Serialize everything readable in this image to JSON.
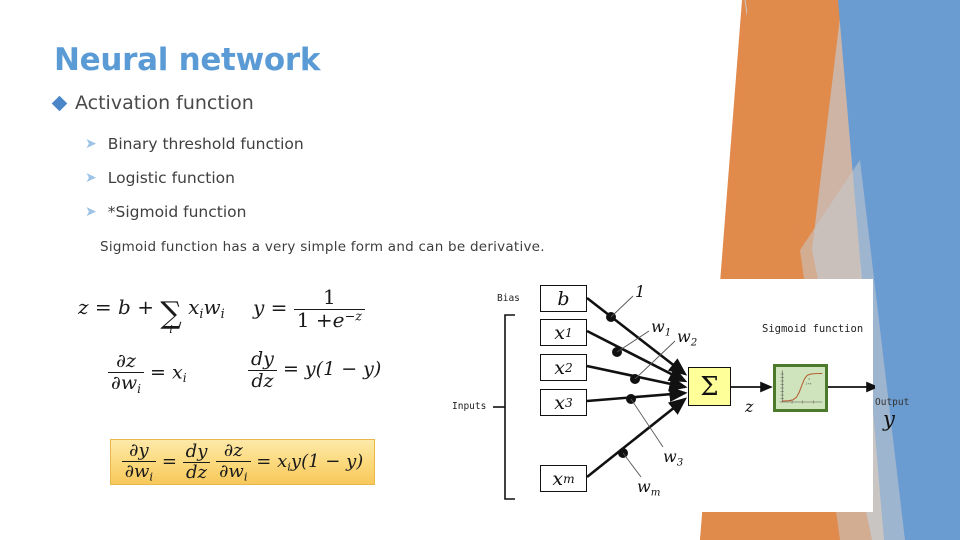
{
  "slide": {
    "title": "Neural network",
    "bullets_level1": [
      {
        "marker": "diamond",
        "label": "Activation function"
      }
    ],
    "bullets_level2": [
      {
        "marker": "arrow",
        "label": "Binary threshold function"
      },
      {
        "marker": "arrow",
        "label": "Logistic function"
      },
      {
        "marker": "arrow",
        "label": "*Sigmoid function"
      }
    ],
    "body_text": "Sigmoid function has a very simple form and can be derivative."
  },
  "colors": {
    "title": "#5B9BD5",
    "bullet_diamond": "#4A86C8",
    "bullet_arrow": "#9DC3E6",
    "highlight_box": "#F7C85C",
    "sigma_box": "#FFFF99",
    "plot_box_fill": "#CFE3BC",
    "plot_box_border": "#4B7A2A",
    "deco_orange": "#E08A4B",
    "deco_blue": "#6A9BD1",
    "deco_light_blue": "#BDD7EE",
    "deco_grey": "#C9CBCD"
  },
  "formulas": {
    "z": {
      "lhs": "z",
      "eq": "=",
      "bias": "b",
      "plus": "+",
      "sum": "∑",
      "sum_index": "i",
      "term_x": "x",
      "term_x_sub": "i",
      "term_w": "w",
      "term_w_sub": "i"
    },
    "y": {
      "lhs": "y",
      "eq": "=",
      "numerator": "1",
      "denominator_one": "1 +",
      "denominator_e": "e",
      "denominator_exp": "−z"
    },
    "dz_dwi": {
      "num_top": "∂z",
      "num_bottom_w": "∂w",
      "num_bottom_sub": "i",
      "eq": "=",
      "rhs": "x",
      "rhs_sub": "i"
    },
    "dy_dz": {
      "num_top": "dy",
      "num_bottom": "dz",
      "eq": "=",
      "rhs": "y(1 − y)"
    },
    "chain_rule": {
      "t1_top": "∂y",
      "t1_bot": "∂w",
      "t1_sub": "i",
      "eq1": "=",
      "t2_top": "dy",
      "t2_bot": "dz",
      "t3_top": "∂z",
      "t3_bot": "∂w",
      "t3_sub": "i",
      "eq2": "=",
      "rhs_x": "x",
      "rhs_x_sub": "i",
      "rhs_rest": "y(1 − y)"
    }
  },
  "diagram": {
    "bias_label": "Bias",
    "inputs_label": "Inputs",
    "nodes": [
      {
        "name": "bias-node",
        "text": "b"
      },
      {
        "name": "input-node-x1",
        "text": "x",
        "sub": "1"
      },
      {
        "name": "input-node-x2",
        "text": "x",
        "sub": "2"
      },
      {
        "name": "input-node-x3",
        "text": "x",
        "sub": "3"
      },
      {
        "name": "input-node-xm",
        "text": "x",
        "sub": "m"
      }
    ],
    "weights": [
      {
        "name": "weight-bias",
        "text": "1"
      },
      {
        "name": "weight-w1",
        "text": "w",
        "sub": "1"
      },
      {
        "name": "weight-w2",
        "text": "w",
        "sub": "2"
      },
      {
        "name": "weight-w3",
        "text": "w",
        "sub": "3"
      },
      {
        "name": "weight-wm",
        "text": "w",
        "sub": "m"
      }
    ],
    "summation_symbol": "Σ",
    "z_label": "z",
    "sigmoid_title": "Sigmoid function",
    "output_label": "Output",
    "output_symbol": "y"
  },
  "chart_data": {
    "type": "line",
    "title": "Sigmoid function",
    "xlabel": "",
    "ylabel": "",
    "annotation": "1 / (1 + e^-z)",
    "x": [
      -6,
      -5,
      -4,
      -3,
      -2,
      -1,
      0,
      1,
      2,
      3,
      4,
      5,
      6
    ],
    "values": [
      0.002,
      0.007,
      0.018,
      0.047,
      0.119,
      0.269,
      0.5,
      0.731,
      0.881,
      0.953,
      0.982,
      0.993,
      0.998
    ],
    "ylim": [
      0,
      1
    ],
    "xlim": [
      -6,
      6
    ],
    "grid": false,
    "legend": "none"
  }
}
